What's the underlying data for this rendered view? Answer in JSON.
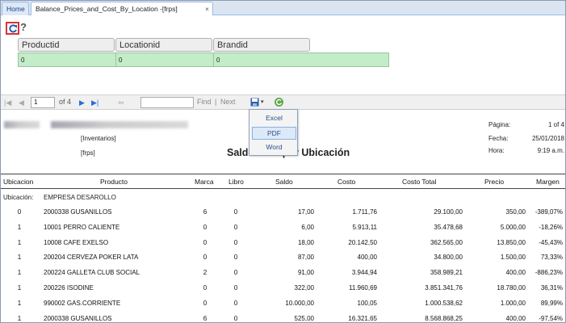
{
  "tabs": {
    "home": "Home",
    "active": "Balance_Prices_and_Cost_By_Location -[frps]",
    "close_glyph": "×"
  },
  "params": {
    "help": "?",
    "productid": {
      "label": "Productid",
      "value": "0"
    },
    "locationid": {
      "label": "Locationid",
      "value": "0"
    },
    "brandid": {
      "label": "Brandid",
      "value": "0"
    }
  },
  "toolbar": {
    "page_value": "1",
    "of_pages": "of 4",
    "find": "Find",
    "separator": "|",
    "next": "Next"
  },
  "export_menu": {
    "excel": "Excel",
    "pdf": "PDF",
    "word": "Word"
  },
  "report": {
    "inventarios": "[Inventarios]",
    "frps": "[frps]",
    "title": "Saldo ... ea por Ubicación",
    "pagina_label": "Página:",
    "pagina_value": "1 of 4",
    "fecha_label": "Fecha:",
    "fecha_value": "25/01/2018",
    "hora_label": "Hora:",
    "hora_value": "9:19 a.m.",
    "group_label": "Ubicación:",
    "group_value": "EMPRESA DESAROLLO"
  },
  "table": {
    "headers": [
      "Ubicacion",
      "Producto",
      "Marca",
      "Libro",
      "Saldo",
      "Costo",
      "Costo Total",
      "Precio",
      "Margen"
    ],
    "rows": [
      [
        "0",
        "2000338 GUSANILLOS",
        "6",
        "0",
        "17,00",
        "1.711,76",
        "29.100,00",
        "350,00",
        "-389,07%"
      ],
      [
        "1",
        "10001 PERRO CALIENTE",
        "0",
        "0",
        "6,00",
        "5.913,11",
        "35.478,68",
        "5.000,00",
        "-18,26%"
      ],
      [
        "1",
        "10008 CAFE EXELSO",
        "0",
        "0",
        "18,00",
        "20.142,50",
        "362.565,00",
        "13.850,00",
        "-45,43%"
      ],
      [
        "1",
        "200204 CERVEZA POKER LATA",
        "0",
        "0",
        "87,00",
        "400,00",
        "34.800,00",
        "1.500,00",
        "73,33%"
      ],
      [
        "1",
        "200224 GALLETA CLUB SOCIAL",
        "2",
        "0",
        "91,00",
        "3.944,94",
        "358.989,21",
        "400,00",
        "-886,23%"
      ],
      [
        "1",
        "200226 ISODINE",
        "0",
        "0",
        "322,00",
        "11.960,69",
        "3.851.341,76",
        "18.780,00",
        "36,31%"
      ],
      [
        "1",
        "990002 GAS.CORRIENTE",
        "0",
        "0",
        "10.000,00",
        "100,05",
        "1.000.538,62",
        "1.000,00",
        "89,99%"
      ],
      [
        "1",
        "2000338 GUSANILLOS",
        "6",
        "0",
        "525,00",
        "16.321,65",
        "8.568.868,25",
        "400,00",
        "-97,54%"
      ]
    ]
  }
}
